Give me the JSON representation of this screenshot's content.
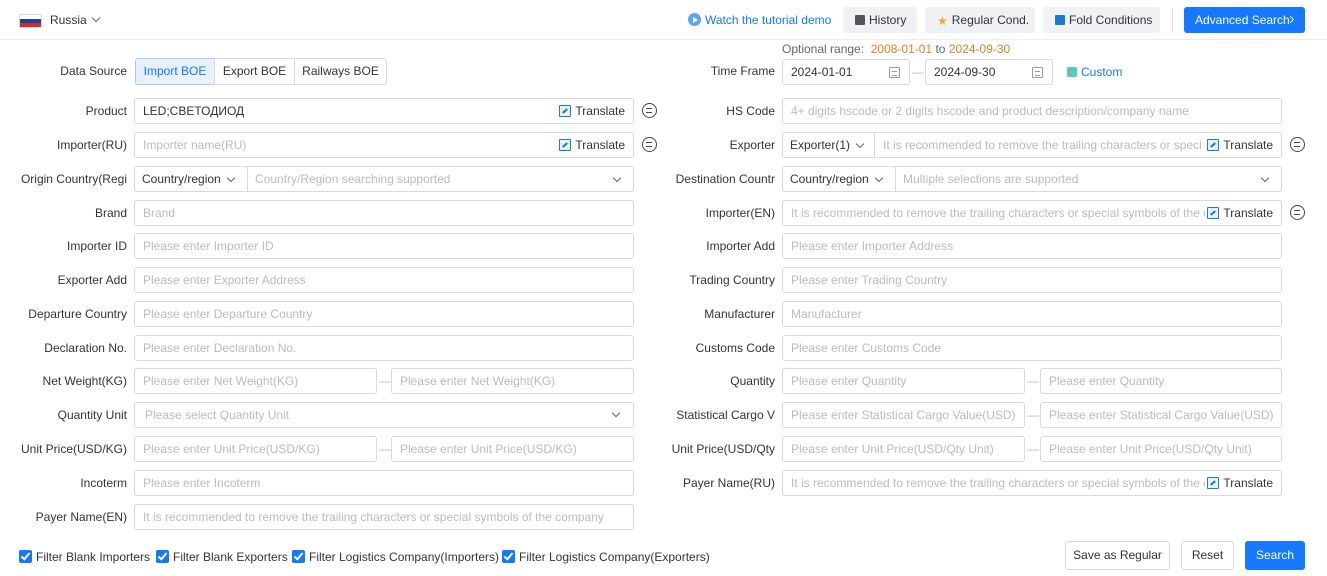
{
  "header": {
    "country": "Russia",
    "tutorial": "Watch the tutorial demo",
    "history": "History",
    "regular": "Regular Cond.",
    "fold": "Fold Conditions",
    "advanced": "Advanced Search",
    "colors": {
      "primary": "#1677ff",
      "date_highlight": "#e67e22"
    }
  },
  "data_source": {
    "label": "Data Source",
    "options": [
      "Import BOE",
      "Export BOE",
      "Railways BOE"
    ],
    "selected": "Import BOE"
  },
  "time": {
    "optional_prefix": "Optional range:",
    "range_from": "2008-01-01",
    "range_to_word": "to",
    "range_to": "2024-09-30",
    "label": "Time Frame",
    "start": "2024-01-01",
    "end": "2024-09-30",
    "custom": "Custom"
  },
  "translate": "Translate",
  "dash": "—",
  "fields": {
    "product": {
      "label": "Product",
      "value": "LED;СВЕТОДИОД"
    },
    "hs_code": {
      "label": "HS Code",
      "placeholder": "4+ digits hscode or 2 digits hscode and product description/company name"
    },
    "importer_ru": {
      "label": "Importer(RU)",
      "placeholder": "Importer name(RU)"
    },
    "exporter": {
      "label": "Exporter",
      "select": "Exporter(1)",
      "placeholder": "It is recommended to remove the trailing characters or special s"
    },
    "origin": {
      "label": "Origin Country(Regi",
      "select": "Country/region",
      "placeholder": "Country/Region searching supported"
    },
    "destination": {
      "label": "Destination Countr",
      "select": "Country/region",
      "placeholder": "Multiple selections are supported"
    },
    "brand": {
      "label": "Brand",
      "placeholder": "Brand"
    },
    "importer_en": {
      "label": "Importer(EN)",
      "placeholder": "It is recommended to remove the trailing characters or special symbols of the com"
    },
    "importer_id": {
      "label": "Importer ID",
      "placeholder": "Please enter Importer ID"
    },
    "importer_add": {
      "label": "Importer Add",
      "placeholder": "Please enter Importer Address"
    },
    "exporter_add": {
      "label": "Exporter Add",
      "placeholder": "Please enter Exporter Address"
    },
    "trading_country": {
      "label": "Trading Country",
      "placeholder": "Please enter Trading Country"
    },
    "departure_country": {
      "label": "Departure Country",
      "placeholder": "Please enter Departure Country"
    },
    "manufacturer": {
      "label": "Manufacturer",
      "placeholder": "Manufacturer"
    },
    "declaration_no": {
      "label": "Declaration No.",
      "placeholder": "Please enter Declaration No."
    },
    "customs_code": {
      "label": "Customs Code",
      "placeholder": "Please enter Customs Code"
    },
    "net_weight": {
      "label": "Net Weight(KG)",
      "placeholder": "Please enter Net Weight(KG)"
    },
    "quantity": {
      "label": "Quantity",
      "placeholder": "Please enter Quantity"
    },
    "quantity_unit": {
      "label": "Quantity Unit",
      "placeholder": "Please select Quantity Unit"
    },
    "stat_cargo": {
      "label": "Statistical Cargo V",
      "placeholder": "Please enter Statistical Cargo Value(USD)"
    },
    "unit_price_kg": {
      "label": "Unit Price(USD/KG)",
      "placeholder": "Please enter Unit Price(USD/KG)"
    },
    "unit_price_qty": {
      "label": "Unit Price(USD/Qty",
      "placeholder": "Please enter Unit Price(USD/Qty Unit)"
    },
    "incoterm": {
      "label": "Incoterm",
      "placeholder": "Please enter Incoterm"
    },
    "payer_ru": {
      "label": "Payer Name(RU)",
      "placeholder": "It is recommended to remove the trailing characters or special symbols of the com"
    },
    "payer_en": {
      "label": "Payer Name(EN)",
      "placeholder": "It is recommended to remove the trailing characters or special symbols of the company"
    }
  },
  "filters": [
    "Filter Blank Importers",
    "Filter Blank Exporters",
    "Filter Logistics Company(Importers)",
    "Filter Logistics Company(Exporters)"
  ],
  "actions": {
    "save": "Save as Regular",
    "reset": "Reset",
    "search": "Search"
  }
}
